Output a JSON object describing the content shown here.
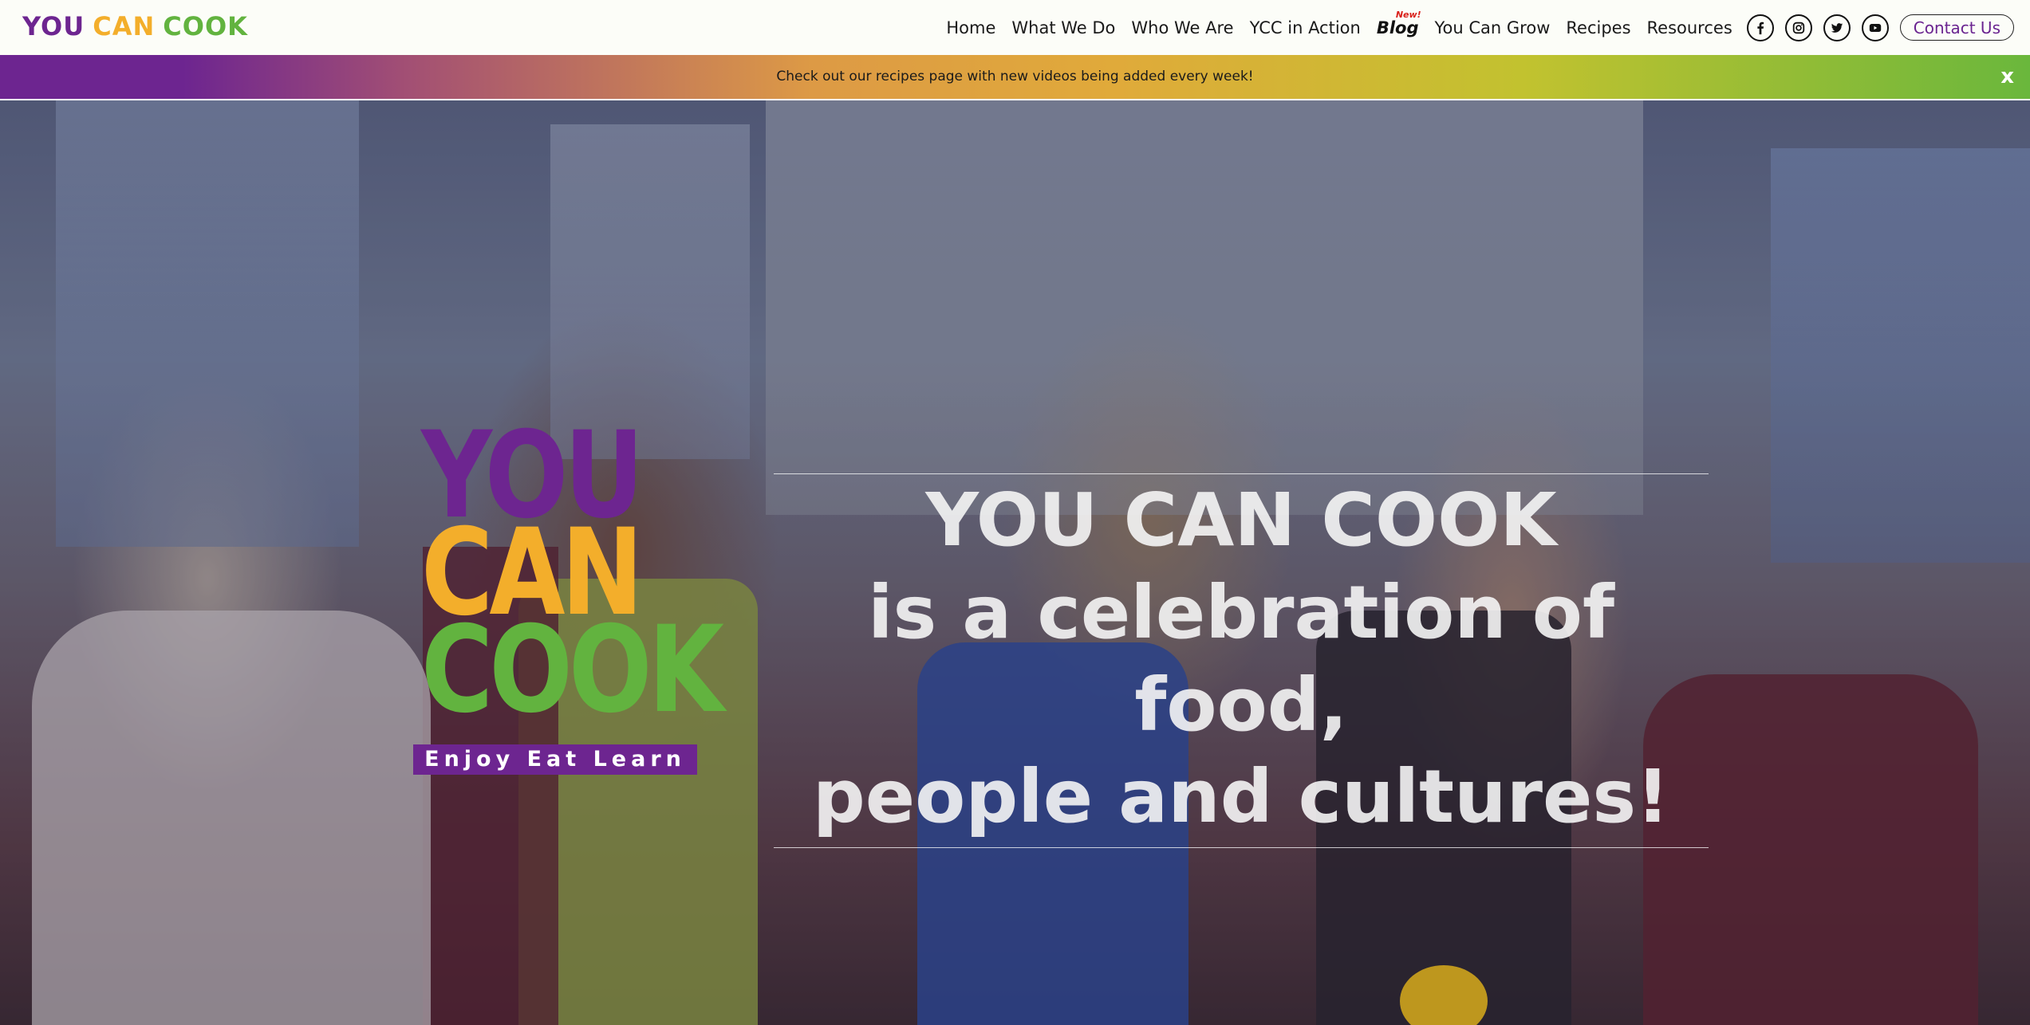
{
  "brand": {
    "word1": "YOU",
    "word2": "CAN",
    "word3": "COOK",
    "color1": "#6d2590",
    "color2": "#f3ae2b",
    "color3": "#62b33f"
  },
  "nav": {
    "items": [
      "Home",
      "What We Do",
      "Who We Are",
      "YCC in Action"
    ],
    "blog_label": "Blog",
    "blog_badge": "New!",
    "items_after": [
      "You Can Grow",
      "Recipes",
      "Resources"
    ],
    "social_icons": [
      "facebook-icon",
      "instagram-icon",
      "twitter-icon",
      "youtube-icon"
    ],
    "contact_label": "Contact Us"
  },
  "announcement": {
    "text": "Check out our recipes page with new videos being added every week!",
    "close_label": "x"
  },
  "hero": {
    "logo_word1": "YOU",
    "logo_word2": "CAN",
    "logo_word3": "COOK",
    "tagline": "Enjoy Eat Learn",
    "title_line1": "YOU CAN COOK",
    "title_line2": "is a celebration of food,",
    "title_line3": "people and cultures!"
  }
}
